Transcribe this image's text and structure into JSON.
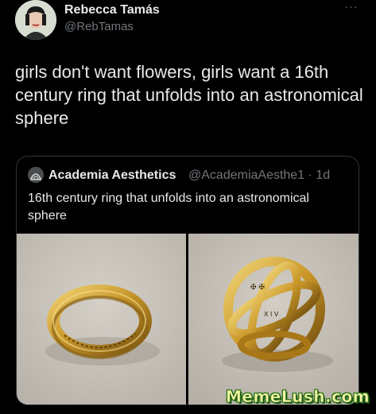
{
  "tweet": {
    "author_name": "Rebecca Tamás",
    "author_handle": "@RebTamas",
    "more_label": "···",
    "text": "girls don't want flowers, girls want a 16th century ring that unfolds into an astronomical sphere"
  },
  "quoted_tweet": {
    "author_name": "Academia Aesthetics",
    "author_handle": "@AcademiaAesthe1 · 1d",
    "text": "16th century ring that unfolds into an astronomical sphere",
    "images": [
      "gold-ring-closed-photo",
      "gold-ring-astronomical-sphere-photo"
    ]
  },
  "watermark": "MemeLush.com",
  "colors": {
    "background": "#000000",
    "text_primary": "#e7e9ea",
    "text_secondary": "#71767b",
    "border": "#2f3336",
    "gold": "#c89a2a"
  }
}
